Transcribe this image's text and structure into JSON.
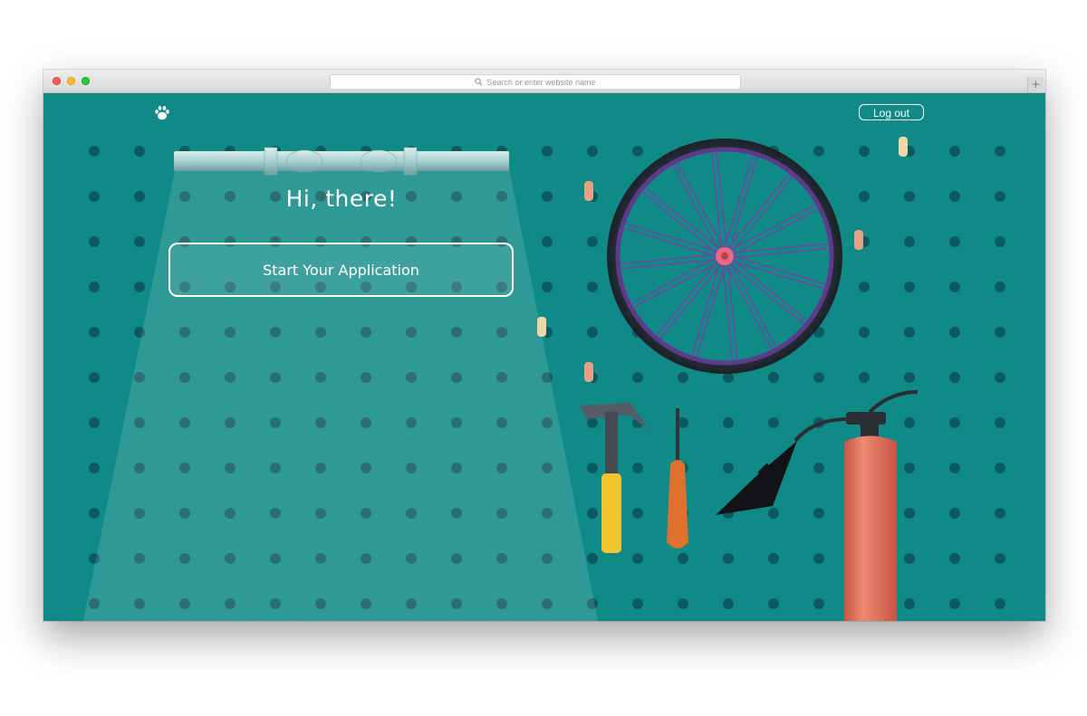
{
  "browser": {
    "url_placeholder": "Search or enter website name",
    "new_tab_label": "+"
  },
  "header": {
    "logout_label": "Log out"
  },
  "hero": {
    "greeting": "Hi, there!",
    "cta_label": "Start Your Application"
  },
  "colors": {
    "background": "#0f8a86",
    "peg_hole": "#0c5a5e",
    "wheel_spokes": "#7a3fa6",
    "extinguisher": "#e06f5c"
  },
  "icons": {
    "logo": "paw-icon",
    "search": "search-icon"
  }
}
